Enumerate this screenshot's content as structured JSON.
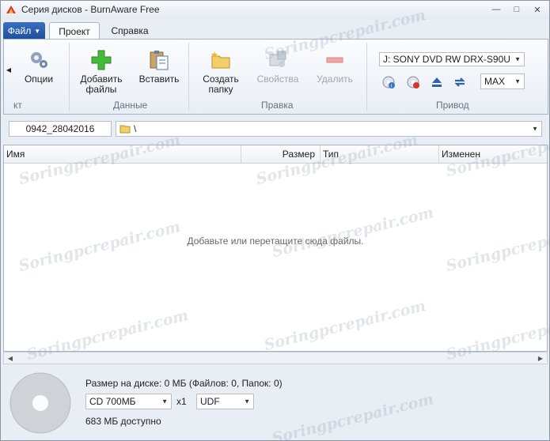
{
  "window": {
    "title": "Серия дисков - BurnAware Free"
  },
  "tabs": {
    "file": "Файл",
    "project": "Проект",
    "help": "Справка"
  },
  "ribbon": {
    "options": "Опции",
    "add_files_1": "Добавить",
    "add_files_2": "файлы",
    "paste": "Вставить",
    "create_folder_1": "Создать",
    "create_folder_2": "папку",
    "properties": "Свойства",
    "delete": "Удалить",
    "group_cut": "кт",
    "group_data": "Данные",
    "group_edit": "Правка",
    "group_drive": "Привод",
    "drive": "J: SONY DVD RW DRX-S90U",
    "speed": "MAX"
  },
  "path": {
    "disc_label": "0942_28042016",
    "current": "\\"
  },
  "list": {
    "columns": [
      "Имя",
      "Размер",
      "Тип",
      "Изменен"
    ],
    "empty_hint": "Добавьте или перетащите сюда файлы."
  },
  "status": {
    "size_info": "Размер на диске: 0 МБ (Файлов: 0, Папок: 0)",
    "disc_type": "CD 700МБ",
    "multiplier": "x1",
    "filesystem": "UDF",
    "available": "683 МБ доступно"
  },
  "watermark": "Soringpcrepair.com",
  "colors": {
    "accent": "#1f4f9c",
    "ribbon_border": "#a8b4c4",
    "green_plus": "#46b83a"
  }
}
